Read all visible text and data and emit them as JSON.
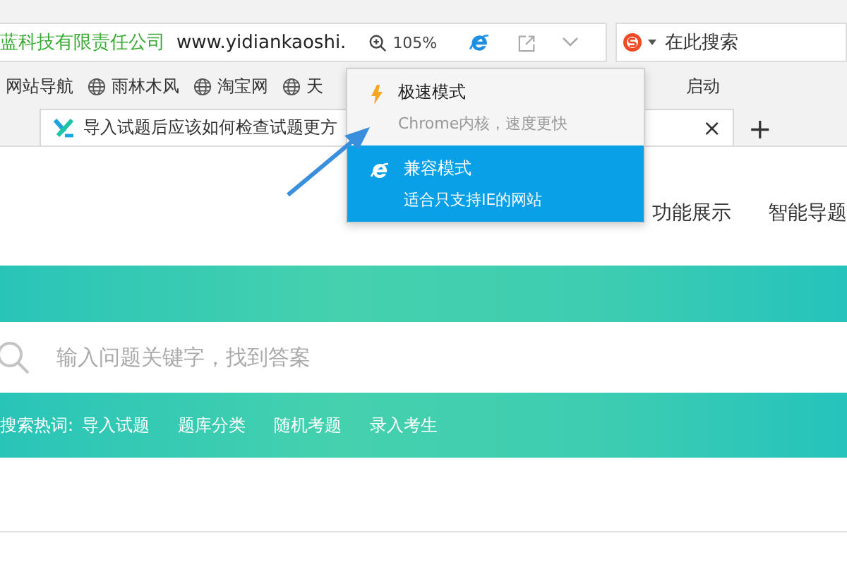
{
  "address_bar": {
    "site_name": "蓝科技有限责任公司",
    "url": "www.yidiankaoshi.",
    "zoom": "105%"
  },
  "search_box": {
    "placeholder": "在此搜索"
  },
  "bookmarks": [
    "网站导航",
    "雨林木风",
    "淘宝网",
    "天",
    "启动"
  ],
  "tabs": [
    {
      "title": "导入试题后应该如何检查试题更方",
      "selected": true,
      "close": "×"
    }
  ],
  "new_tab": "+",
  "mode_menu": {
    "items": [
      {
        "kind": "speed",
        "title": "极速模式",
        "subtitle": "Chrome内核，速度更快",
        "selected": false
      },
      {
        "kind": "ie",
        "title": "兼容模式",
        "subtitle": "适合只支持IE的网站",
        "selected": true
      }
    ]
  },
  "page": {
    "nav": [
      "功能展示",
      "智能导题"
    ],
    "search": {
      "placeholder": "输入问题关键字，找到答案"
    },
    "hot_words": {
      "label": "搜索热词:",
      "words": [
        "导入试题",
        "题库分类",
        "随机考题",
        "录入考生"
      ]
    }
  }
}
